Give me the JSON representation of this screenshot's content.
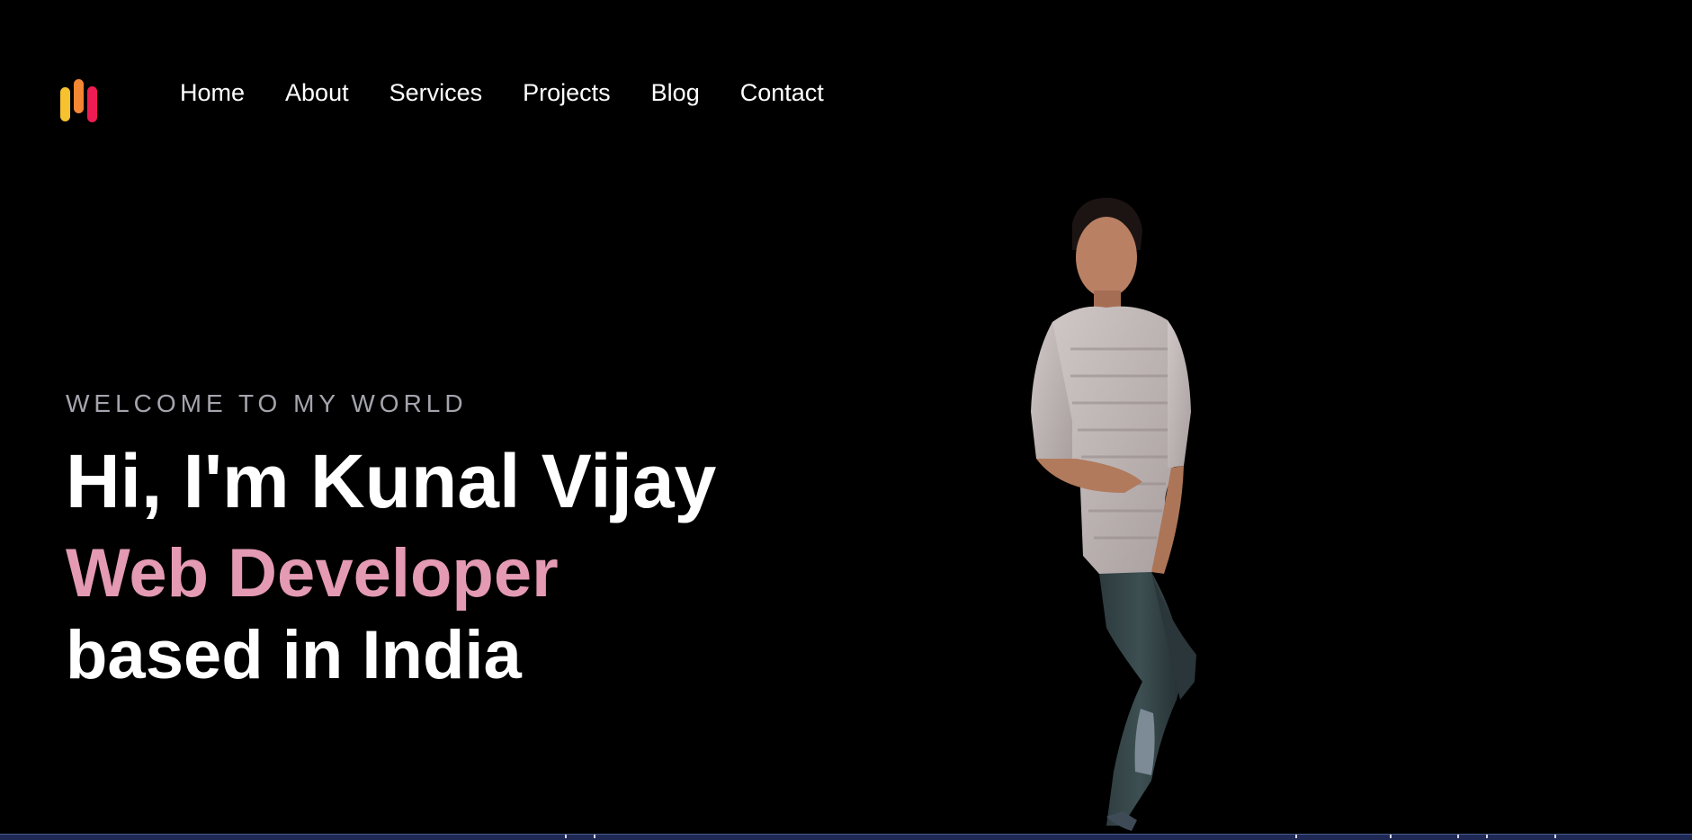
{
  "logo": {
    "icon": "bars-logo-icon",
    "colors": [
      "#f6c22f",
      "#f58634",
      "#ee1c52"
    ]
  },
  "nav": {
    "items": [
      {
        "label": "Home"
      },
      {
        "label": "About"
      },
      {
        "label": "Services"
      },
      {
        "label": "Projects"
      },
      {
        "label": "Blog"
      },
      {
        "label": "Contact"
      }
    ]
  },
  "hero": {
    "tagline": "WELCOME TO MY WORLD",
    "headline": "Hi, I'm Kunal Vijay",
    "role": "Web Developer",
    "location": "based in India",
    "accent_color": "#e49ab3",
    "portrait_icon": "portrait-photo"
  }
}
